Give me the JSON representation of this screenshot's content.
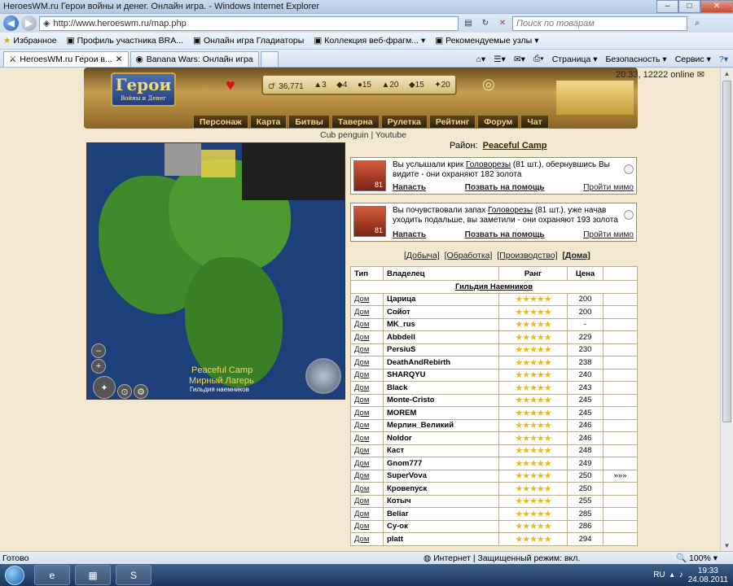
{
  "window": {
    "title": "HeroesWM.ru Герои войны и денег. Онлайн игра. - Windows Internet Explorer"
  },
  "address": {
    "url": "http://www.heroeswm.ru/map.php",
    "search_placeholder": "Поиск по товарам"
  },
  "favorites": {
    "label": "Избранное",
    "items": [
      "Профиль участника BRA...",
      "Онлайн игра Гладиаторы",
      "Коллекция веб-фрагм...",
      "Рекомендуемые узлы"
    ]
  },
  "tabs": [
    {
      "label": "HeroesWM.ru Герои в..."
    },
    {
      "label": "Banana Wars: Онлайн игра"
    }
  ],
  "toolbar": {
    "page": "Страница",
    "safety": "Безопасность",
    "service": "Сервис"
  },
  "game": {
    "logo_title": "Герои",
    "logo_sub": "Войны и Денег",
    "status": "20:33, 12222 online",
    "resources": [
      "36,771",
      "3",
      "4",
      "15",
      "20",
      "15",
      "20"
    ],
    "menu": [
      "Персонаж",
      "Карта",
      "Битвы",
      "Таверна",
      "Рулетка",
      "Рейтинг",
      "Форум",
      "Чат"
    ],
    "sublinks": "Cub penguin | Youtube",
    "map_labels": {
      "en": "Peaceful Camp",
      "ru": "Мирный Лагерь",
      "guild": "Гильдия наемников"
    },
    "district_label": "Район:",
    "district_name": "Peaceful Camp",
    "events": [
      {
        "level": "81",
        "msg_a": "Вы услышали крик ",
        "link": "Головорезы",
        "msg_b": " (81 шт.), обернувшись Вы видите - они охраняют 182 золота",
        "attack": "Напасть",
        "help": "Позвать на помощь",
        "pass": "Пройти мимо"
      },
      {
        "level": "81",
        "msg_a": "Вы почувствовали запах ",
        "link": "Головорезы",
        "msg_b": " (81 шт.), уже начав уходить подальше, вы заметили - они охраняют 193 золота",
        "attack": "Напасть",
        "help": "Позвать на помощь",
        "pass": "Пройти мимо"
      }
    ],
    "filters": [
      "[Добыча]",
      "[Обработка]",
      "[Производство]",
      "[Дома]"
    ],
    "table": {
      "headers": [
        "Тип",
        "Владелец",
        "Ранг",
        "Цена"
      ],
      "guild": "Гильдия Наемников",
      "rows": [
        {
          "type": "Дом",
          "owner": "Царица",
          "price": "200",
          "extra": ""
        },
        {
          "type": "Дом",
          "owner": "Сойот",
          "price": "200",
          "extra": ""
        },
        {
          "type": "Дом",
          "owner": "MK_rus",
          "price": "-",
          "extra": ""
        },
        {
          "type": "Дом",
          "owner": "Abbdell",
          "price": "229",
          "extra": ""
        },
        {
          "type": "Дом",
          "owner": "PersiuS",
          "price": "230",
          "extra": ""
        },
        {
          "type": "Дом",
          "owner": "DeathAndRebirth",
          "price": "238",
          "extra": ""
        },
        {
          "type": "Дом",
          "owner": "SHARQYU",
          "price": "240",
          "extra": ""
        },
        {
          "type": "Дом",
          "owner": "Black",
          "price": "243",
          "extra": ""
        },
        {
          "type": "Дом",
          "owner": "Monte-Cristo",
          "price": "245",
          "extra": ""
        },
        {
          "type": "Дом",
          "owner": "MOREM",
          "price": "245",
          "extra": ""
        },
        {
          "type": "Дом",
          "owner": "Мерлин_Великий",
          "price": "246",
          "extra": ""
        },
        {
          "type": "Дом",
          "owner": "Noldor",
          "price": "246",
          "extra": ""
        },
        {
          "type": "Дом",
          "owner": "Каст",
          "price": "248",
          "extra": ""
        },
        {
          "type": "Дом",
          "owner": "Gnom777",
          "price": "249",
          "extra": ""
        },
        {
          "type": "Дом",
          "owner": "SuperVova",
          "price": "250",
          "extra": "»»»"
        },
        {
          "type": "Дом",
          "owner": "Кровепуск",
          "price": "250",
          "extra": ""
        },
        {
          "type": "Дом",
          "owner": "Котыч",
          "price": "255",
          "extra": ""
        },
        {
          "type": "Дом",
          "owner": "Beliar",
          "price": "285",
          "extra": ""
        },
        {
          "type": "Дом",
          "owner": "Cy-ок",
          "price": "286",
          "extra": ""
        },
        {
          "type": "Дом",
          "owner": "platt",
          "price": "294",
          "extra": ""
        }
      ]
    }
  },
  "statusbar": {
    "ready": "Готово",
    "zone": "Интернет | Защищенный режим: вкл.",
    "zoom": "100%"
  },
  "taskbar": {
    "lang": "RU",
    "time": "19:33",
    "date": "24.08.2011"
  }
}
